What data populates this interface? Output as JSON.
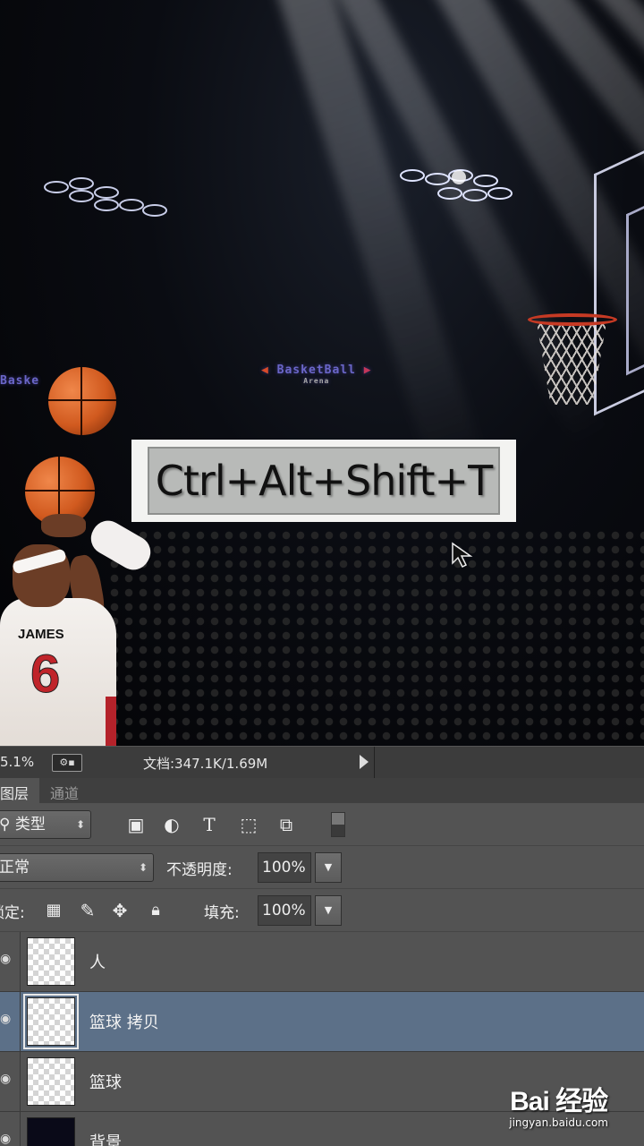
{
  "overlay": {
    "shortcut": "Ctrl+Alt+Shift+T"
  },
  "statusbar": {
    "zoom": "5.1%",
    "doc_info": "文档:347.1K/1.69M"
  },
  "panel": {
    "tabs": [
      {
        "label": "图层"
      },
      {
        "label": "通道"
      }
    ],
    "filter": {
      "kind_label": "类型"
    },
    "blend": {
      "mode": "正常",
      "opacity_label": "不透明度:",
      "opacity_value": "100%"
    },
    "lock": {
      "label": "锁定:",
      "fill_label": "填充:",
      "fill_value": "100%"
    }
  },
  "layers": [
    {
      "name": "人",
      "selected": false
    },
    {
      "name": "篮球 拷贝",
      "selected": true
    },
    {
      "name": "篮球",
      "selected": false
    },
    {
      "name": "背景",
      "selected": false
    }
  ],
  "canvas_text": {
    "banner": "BasketBall",
    "banner_sub": "Arena",
    "banner_left": "Baske",
    "jersey_name": "JAMES",
    "jersey_number": "6"
  },
  "watermark": {
    "logo": "Bai  经验",
    "url": "jingyan.baidu.com"
  },
  "colors": {
    "selected_layer": "#5c7088",
    "panel_bg": "#535353",
    "status_bg": "#3c3c3c"
  }
}
